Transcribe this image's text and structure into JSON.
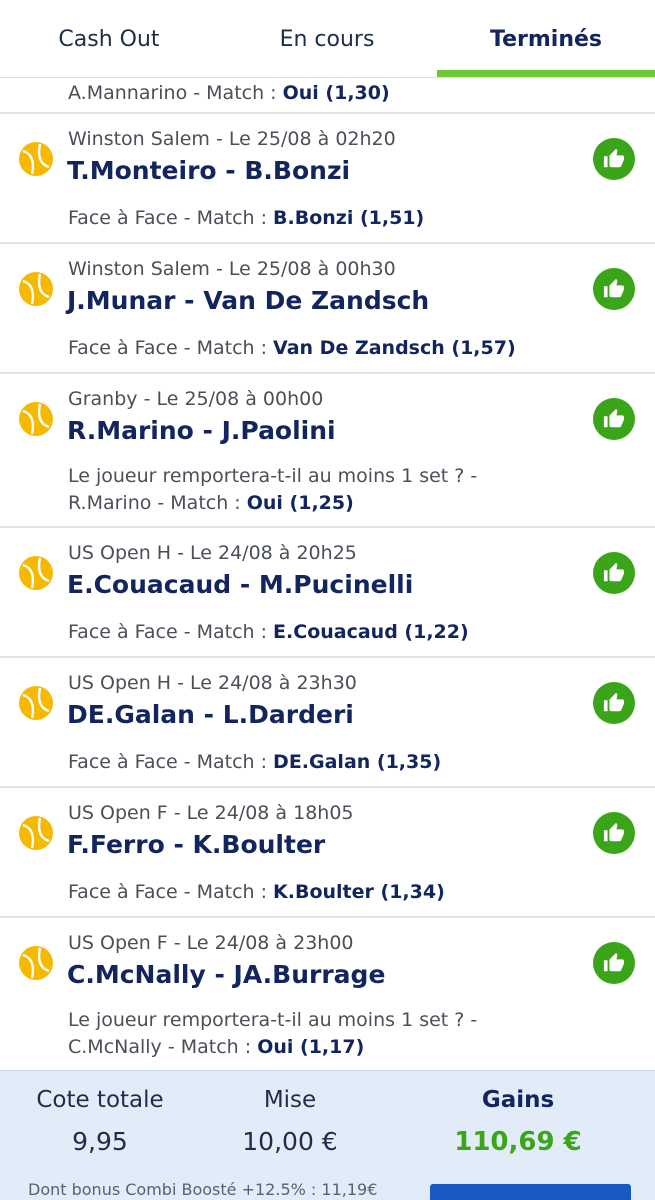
{
  "tabs": [
    {
      "label": "Cash Out"
    },
    {
      "label": "En cours"
    },
    {
      "label": "Terminés"
    }
  ],
  "partial_bet": {
    "detail_prefix": "A.Mannarino - Match : ",
    "selection": "Oui (1,30)"
  },
  "bets": [
    {
      "meta": "Winston Salem - Le 25/08 à 02h20",
      "match": "T.Monteiro - B.Bonzi",
      "detail_prefix": "Face à Face - Match : ",
      "selection": "B.Bonzi (1,51)"
    },
    {
      "meta": "Winston Salem - Le 25/08 à 00h30",
      "match": "J.Munar - Van De Zandsch",
      "detail_prefix": "Face à Face - Match : ",
      "selection": "Van De Zandsch (1,57)"
    },
    {
      "meta": "Granby - Le 25/08 à 00h00",
      "match": "R.Marino - J.Paolini",
      "detail_line1": "Le joueur remportera-t-il au moins 1 set ? -",
      "detail_prefix": "R.Marino - Match : ",
      "selection": "Oui (1,25)"
    },
    {
      "meta": "US Open H - Le 24/08 à 20h25",
      "match": "E.Couacaud - M.Pucinelli",
      "detail_prefix": "Face à Face - Match : ",
      "selection": "E.Couacaud (1,22)"
    },
    {
      "meta": "US Open H - Le 24/08 à 23h30",
      "match": "DE.Galan - L.Darderi",
      "detail_prefix": "Face à Face - Match : ",
      "selection": "DE.Galan (1,35)"
    },
    {
      "meta": "US Open F - Le 24/08 à 18h05",
      "match": "F.Ferro - K.Boulter",
      "detail_prefix": "Face à Face - Match : ",
      "selection": "K.Boulter (1,34)"
    },
    {
      "meta": "US Open F - Le 24/08 à 23h00",
      "match": "C.McNally - JA.Burrage",
      "detail_line1": "Le joueur remportera-t-il au moins 1 set ? -",
      "detail_prefix": "C.McNally - Match : ",
      "selection": "Oui (1,17)"
    }
  ],
  "summary": {
    "cote_label": "Cote totale",
    "cote_value": "9,95",
    "mise_label": "Mise",
    "mise_value": "10,00 €",
    "gains_label": "Gains",
    "gains_value": "110,69 €",
    "bonus_text": "Dont bonus Combi Boosté +12.5% : 11,19€"
  },
  "colors": {
    "brand_navy": "#12255e",
    "win_green": "#3aa519",
    "tab_indicator": "#6cc833",
    "tennis_ball": "#f6b800",
    "summary_bg": "#e2ecf8"
  },
  "icons": {
    "sport": "tennis-ball-icon",
    "result": "thumbs-up-icon"
  }
}
